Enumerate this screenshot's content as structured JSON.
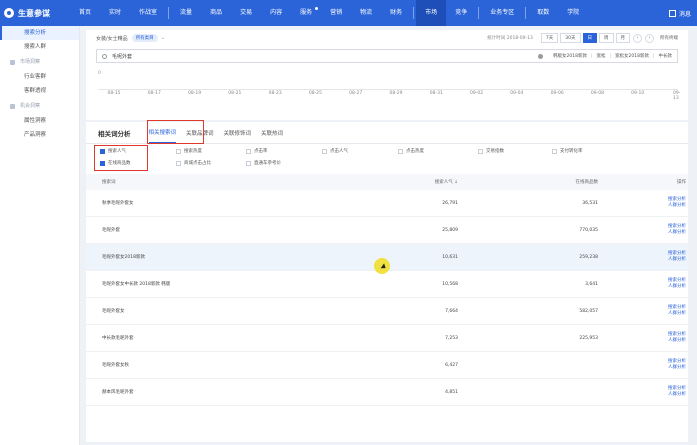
{
  "brand": "生意参谋",
  "nav": {
    "items": [
      {
        "label": "首页"
      },
      {
        "label": "实时"
      },
      {
        "label": "作战室"
      },
      {
        "label": "流量"
      },
      {
        "label": "商品"
      },
      {
        "label": "交易"
      },
      {
        "label": "内容"
      },
      {
        "label": "服务",
        "dot": true
      },
      {
        "label": "营销"
      },
      {
        "label": "物流"
      },
      {
        "label": "财务"
      },
      {
        "label": "市场",
        "active": true
      },
      {
        "label": "竞争"
      },
      {
        "label": "业务专区"
      },
      {
        "label": "取数"
      },
      {
        "label": "学院"
      }
    ],
    "user": "消息"
  },
  "sidebar": {
    "items": [
      {
        "label": "搜索分析",
        "active": true
      },
      {
        "label": "搜索人群"
      }
    ],
    "groups": [
      {
        "label": "市场洞察",
        "items": [
          "行业客群",
          "客群透视"
        ]
      },
      {
        "label": "机会洞察",
        "items": [
          "属性洞察",
          "产品洞察"
        ]
      }
    ]
  },
  "filter": {
    "category": "女装/女士精品",
    "tag": "所有类目",
    "stat_time": "统计时间 2018-09-13",
    "periods": [
      "7天",
      "30天",
      "日",
      "周",
      "月"
    ],
    "active_period": "日",
    "channel": "所有终端",
    "search_value": "毛呢外套",
    "related": [
      "韩版女2018新款",
      "宽松",
      "宽松女2018新款",
      "中长款"
    ],
    "timeline_zero": "0",
    "dates": [
      "08-15",
      "08-17",
      "08-19",
      "08-21",
      "08-23",
      "08-25",
      "08-27",
      "08-29",
      "08-31",
      "09-02",
      "09-04",
      "09-06",
      "09-08",
      "09-10",
      "09-13"
    ]
  },
  "analysis": {
    "title": "相关词分析",
    "tabs": [
      {
        "label": "相关搜索词",
        "active": true
      },
      {
        "label": "关联品牌词"
      },
      {
        "label": "关联修饰词"
      },
      {
        "label": "关联热词"
      }
    ],
    "metrics": [
      {
        "label": "搜索人气",
        "checked": true
      },
      {
        "label": "搜索热度"
      },
      {
        "label": "点击率"
      },
      {
        "label": "点击人气"
      },
      {
        "label": "点击热度"
      },
      {
        "label": "交易指数"
      },
      {
        "label": "支付转化率"
      },
      {
        "label": "在线商品数",
        "checked": true
      },
      {
        "label": "商城点击占比"
      },
      {
        "label": "直通车参考价"
      }
    ],
    "columns": {
      "word": "搜索词",
      "popularity": "搜索人气 ↓",
      "items": "在线商品数",
      "ops": "操作"
    },
    "op_labels": {
      "a": "搜索分析",
      "b": "人群分析"
    },
    "rows": [
      {
        "word": "秋季毛呢外套女",
        "popularity": "26,791",
        "items": "36,531"
      },
      {
        "word": "毛呢外套",
        "popularity": "25,809",
        "items": "770,035"
      },
      {
        "word": "毛呢外套女2018新款",
        "popularity": "10,631",
        "items": "259,238",
        "highlight": true
      },
      {
        "word": "毛呢外套女中长款 2018新款 韩版",
        "popularity": "10,568",
        "items": "3,641"
      },
      {
        "word": "毛呢外套女",
        "popularity": "7,664",
        "items": "582,057"
      },
      {
        "word": "中长款毛呢外套",
        "popularity": "7,253",
        "items": "225,953"
      },
      {
        "word": "毛呢外套女秋",
        "popularity": "6,427",
        "items": ""
      },
      {
        "word": "赫本风毛呢外套",
        "popularity": "4,851",
        "items": ""
      }
    ]
  }
}
